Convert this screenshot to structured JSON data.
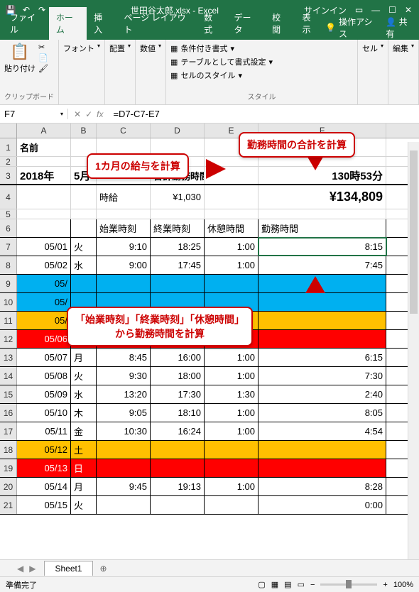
{
  "titlebar": {
    "filename": "世田谷太郎.xlsx - Excel",
    "signin": "サインイン"
  },
  "tabs": {
    "file": "ファイル",
    "home": "ホーム",
    "insert": "挿入",
    "pagelayout": "ページ レイアウト",
    "formulas": "数式",
    "data": "データ",
    "review": "校閲",
    "view": "表示",
    "tellme": "操作アシス",
    "share": "共有"
  },
  "ribbon": {
    "paste": "貼り付け",
    "clipboard": "クリップボード",
    "font": "フォント",
    "alignment": "配置",
    "number": "数値",
    "cond_format": "条件付き書式",
    "table_format": "テーブルとして書式設定",
    "cell_styles": "セルのスタイル",
    "style": "スタイル",
    "cells": "セル",
    "editing": "編集"
  },
  "namebox": "F7",
  "formula": "=D7-C7-E7",
  "callouts": {
    "monthly_pay": "1カ月の給与を計算",
    "total_hours": "勤務時間の合計を計算",
    "work_hours": "「始業時刻」「終業時刻」「休憩時間」\nから勤務時間を計算"
  },
  "cells": {
    "a1": "名前",
    "a3": "2018年",
    "b3": "5月",
    "d3": "合計勤務時間",
    "f3": "130時53分",
    "c4": "時給",
    "d4": "¥1,030",
    "f4": "¥134,809",
    "c6": "始業時刻",
    "d6": "終業時刻",
    "e6": "休憩時間",
    "f6": "勤務時間"
  },
  "rows": [
    {
      "n": 7,
      "date": "05/01",
      "day": "火",
      "start": "9:10",
      "end": "18:25",
      "break": "1:00",
      "work": "8:15",
      "bg": ""
    },
    {
      "n": 8,
      "date": "05/02",
      "day": "水",
      "start": "9:00",
      "end": "17:45",
      "break": "1:00",
      "work": "7:45",
      "bg": ""
    },
    {
      "n": 9,
      "date": "05/",
      "day": "",
      "start": "",
      "end": "",
      "break": "",
      "work": "",
      "bg": "blue"
    },
    {
      "n": 10,
      "date": "05/",
      "day": "",
      "start": "",
      "end": "",
      "break": "",
      "work": "",
      "bg": "blue"
    },
    {
      "n": 11,
      "date": "05/",
      "day": "",
      "start": "",
      "end": "",
      "break": "",
      "work": "",
      "bg": "orange"
    },
    {
      "n": 12,
      "date": "05/06",
      "day": "日",
      "start": "",
      "end": "",
      "break": "",
      "work": "",
      "bg": "red"
    },
    {
      "n": 13,
      "date": "05/07",
      "day": "月",
      "start": "8:45",
      "end": "16:00",
      "break": "1:00",
      "work": "6:15",
      "bg": ""
    },
    {
      "n": 14,
      "date": "05/08",
      "day": "火",
      "start": "9:30",
      "end": "18:00",
      "break": "1:00",
      "work": "7:30",
      "bg": ""
    },
    {
      "n": 15,
      "date": "05/09",
      "day": "水",
      "start": "13:20",
      "end": "17:30",
      "break": "1:30",
      "work": "2:40",
      "bg": ""
    },
    {
      "n": 16,
      "date": "05/10",
      "day": "木",
      "start": "9:05",
      "end": "18:10",
      "break": "1:00",
      "work": "8:05",
      "bg": ""
    },
    {
      "n": 17,
      "date": "05/11",
      "day": "金",
      "start": "10:30",
      "end": "16:24",
      "break": "1:00",
      "work": "4:54",
      "bg": ""
    },
    {
      "n": 18,
      "date": "05/12",
      "day": "土",
      "start": "",
      "end": "",
      "break": "",
      "work": "",
      "bg": "orange"
    },
    {
      "n": 19,
      "date": "05/13",
      "day": "日",
      "start": "",
      "end": "",
      "break": "",
      "work": "",
      "bg": "red"
    },
    {
      "n": 20,
      "date": "05/14",
      "day": "月",
      "start": "9:45",
      "end": "19:13",
      "break": "1:00",
      "work": "8:28",
      "bg": ""
    },
    {
      "n": 21,
      "date": "05/15",
      "day": "火",
      "start": "",
      "end": "",
      "break": "",
      "work": "0:00",
      "bg": ""
    }
  ],
  "sheet_tab": "Sheet1",
  "status": {
    "ready": "準備完了",
    "zoom": "100%"
  }
}
